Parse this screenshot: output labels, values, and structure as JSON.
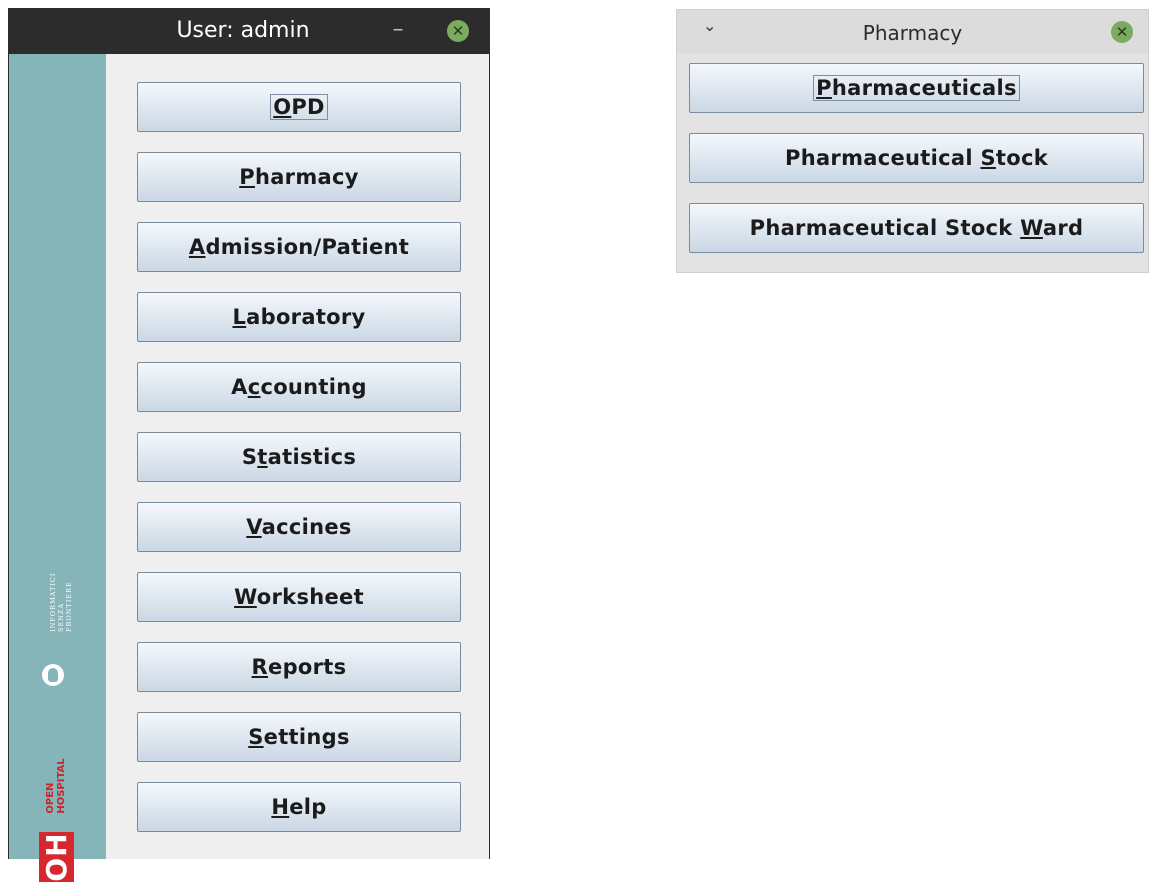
{
  "main_window": {
    "title": "User: admin",
    "minimize_symbol": "–",
    "close_symbol": "✕",
    "sidebar": {
      "org_lines": [
        "INFORMATICI",
        "SENZA",
        "FRONTIERE"
      ],
      "brand_short": "OH",
      "brand_lines": [
        "OPEN",
        "HOSPITAL"
      ]
    },
    "buttons": [
      {
        "pre": "",
        "key": "O",
        "post": "PD",
        "focused": true
      },
      {
        "pre": "",
        "key": "P",
        "post": "harmacy"
      },
      {
        "pre": "",
        "key": "A",
        "post": "dmission/Patient"
      },
      {
        "pre": "",
        "key": "L",
        "post": "aboratory"
      },
      {
        "pre": "A",
        "key": "c",
        "post": "counting"
      },
      {
        "pre": "S",
        "key": "t",
        "post": "atistics"
      },
      {
        "pre": "",
        "key": "V",
        "post": "accines"
      },
      {
        "pre": "",
        "key": "W",
        "post": "orksheet"
      },
      {
        "pre": "",
        "key": "R",
        "post": "eports"
      },
      {
        "pre": "",
        "key": "S",
        "post": "ettings"
      },
      {
        "pre": "",
        "key": "H",
        "post": "elp"
      }
    ]
  },
  "pharmacy_window": {
    "title": "Pharmacy",
    "collapse_symbol": "⌄",
    "close_symbol": "✕",
    "buttons": [
      {
        "pre": "",
        "key": "P",
        "post": "harmaceuticals",
        "focused": true
      },
      {
        "pre": "Pharmaceutical ",
        "key": "S",
        "post": "tock"
      },
      {
        "pre": "Pharmaceutical Stock ",
        "key": "W",
        "post": "ard"
      }
    ]
  },
  "colors": {
    "titlebar_dark": "#2c2c2c",
    "sidebar_teal": "#86b5b9",
    "close_green": "#7aab5f",
    "brand_red": "#d6272e"
  }
}
